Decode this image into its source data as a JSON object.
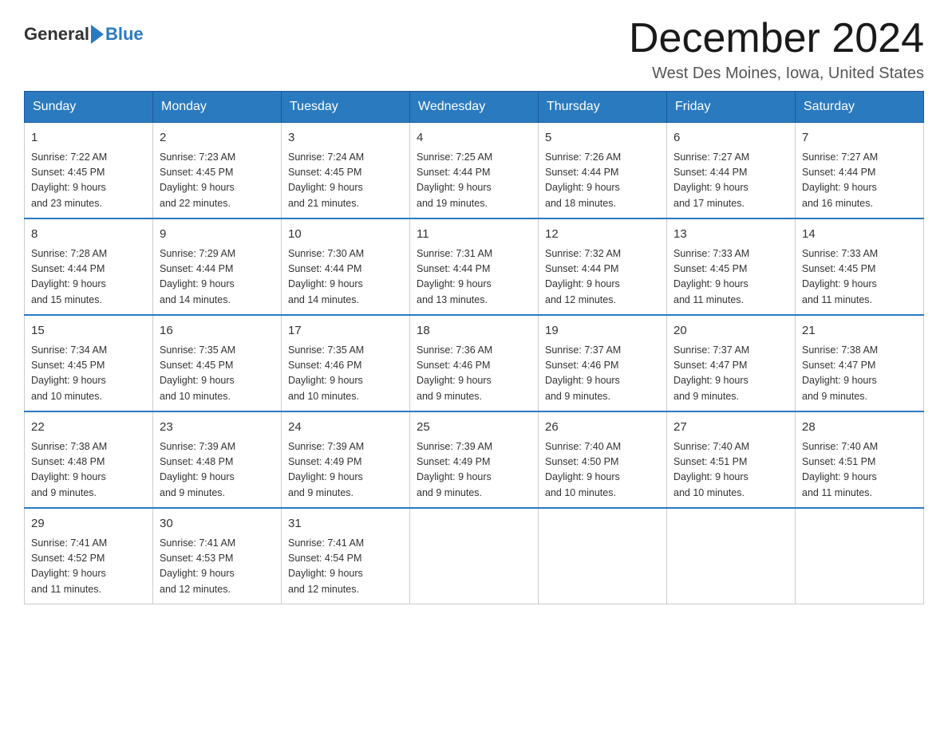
{
  "logo": {
    "text_general": "General",
    "text_blue": "Blue"
  },
  "title": {
    "month_year": "December 2024",
    "location": "West Des Moines, Iowa, United States"
  },
  "weekdays": [
    "Sunday",
    "Monday",
    "Tuesday",
    "Wednesday",
    "Thursday",
    "Friday",
    "Saturday"
  ],
  "weeks": [
    [
      {
        "day": "1",
        "sunrise": "7:22 AM",
        "sunset": "4:45 PM",
        "daylight": "9 hours and 23 minutes."
      },
      {
        "day": "2",
        "sunrise": "7:23 AM",
        "sunset": "4:45 PM",
        "daylight": "9 hours and 22 minutes."
      },
      {
        "day": "3",
        "sunrise": "7:24 AM",
        "sunset": "4:45 PM",
        "daylight": "9 hours and 21 minutes."
      },
      {
        "day": "4",
        "sunrise": "7:25 AM",
        "sunset": "4:44 PM",
        "daylight": "9 hours and 19 minutes."
      },
      {
        "day": "5",
        "sunrise": "7:26 AM",
        "sunset": "4:44 PM",
        "daylight": "9 hours and 18 minutes."
      },
      {
        "day": "6",
        "sunrise": "7:27 AM",
        "sunset": "4:44 PM",
        "daylight": "9 hours and 17 minutes."
      },
      {
        "day": "7",
        "sunrise": "7:27 AM",
        "sunset": "4:44 PM",
        "daylight": "9 hours and 16 minutes."
      }
    ],
    [
      {
        "day": "8",
        "sunrise": "7:28 AM",
        "sunset": "4:44 PM",
        "daylight": "9 hours and 15 minutes."
      },
      {
        "day": "9",
        "sunrise": "7:29 AM",
        "sunset": "4:44 PM",
        "daylight": "9 hours and 14 minutes."
      },
      {
        "day": "10",
        "sunrise": "7:30 AM",
        "sunset": "4:44 PM",
        "daylight": "9 hours and 14 minutes."
      },
      {
        "day": "11",
        "sunrise": "7:31 AM",
        "sunset": "4:44 PM",
        "daylight": "9 hours and 13 minutes."
      },
      {
        "day": "12",
        "sunrise": "7:32 AM",
        "sunset": "4:44 PM",
        "daylight": "9 hours and 12 minutes."
      },
      {
        "day": "13",
        "sunrise": "7:33 AM",
        "sunset": "4:45 PM",
        "daylight": "9 hours and 11 minutes."
      },
      {
        "day": "14",
        "sunrise": "7:33 AM",
        "sunset": "4:45 PM",
        "daylight": "9 hours and 11 minutes."
      }
    ],
    [
      {
        "day": "15",
        "sunrise": "7:34 AM",
        "sunset": "4:45 PM",
        "daylight": "9 hours and 10 minutes."
      },
      {
        "day": "16",
        "sunrise": "7:35 AM",
        "sunset": "4:45 PM",
        "daylight": "9 hours and 10 minutes."
      },
      {
        "day": "17",
        "sunrise": "7:35 AM",
        "sunset": "4:46 PM",
        "daylight": "9 hours and 10 minutes."
      },
      {
        "day": "18",
        "sunrise": "7:36 AM",
        "sunset": "4:46 PM",
        "daylight": "9 hours and 9 minutes."
      },
      {
        "day": "19",
        "sunrise": "7:37 AM",
        "sunset": "4:46 PM",
        "daylight": "9 hours and 9 minutes."
      },
      {
        "day": "20",
        "sunrise": "7:37 AM",
        "sunset": "4:47 PM",
        "daylight": "9 hours and 9 minutes."
      },
      {
        "day": "21",
        "sunrise": "7:38 AM",
        "sunset": "4:47 PM",
        "daylight": "9 hours and 9 minutes."
      }
    ],
    [
      {
        "day": "22",
        "sunrise": "7:38 AM",
        "sunset": "4:48 PM",
        "daylight": "9 hours and 9 minutes."
      },
      {
        "day": "23",
        "sunrise": "7:39 AM",
        "sunset": "4:48 PM",
        "daylight": "9 hours and 9 minutes."
      },
      {
        "day": "24",
        "sunrise": "7:39 AM",
        "sunset": "4:49 PM",
        "daylight": "9 hours and 9 minutes."
      },
      {
        "day": "25",
        "sunrise": "7:39 AM",
        "sunset": "4:49 PM",
        "daylight": "9 hours and 9 minutes."
      },
      {
        "day": "26",
        "sunrise": "7:40 AM",
        "sunset": "4:50 PM",
        "daylight": "9 hours and 10 minutes."
      },
      {
        "day": "27",
        "sunrise": "7:40 AM",
        "sunset": "4:51 PM",
        "daylight": "9 hours and 10 minutes."
      },
      {
        "day": "28",
        "sunrise": "7:40 AM",
        "sunset": "4:51 PM",
        "daylight": "9 hours and 11 minutes."
      }
    ],
    [
      {
        "day": "29",
        "sunrise": "7:41 AM",
        "sunset": "4:52 PM",
        "daylight": "9 hours and 11 minutes."
      },
      {
        "day": "30",
        "sunrise": "7:41 AM",
        "sunset": "4:53 PM",
        "daylight": "9 hours and 12 minutes."
      },
      {
        "day": "31",
        "sunrise": "7:41 AM",
        "sunset": "4:54 PM",
        "daylight": "9 hours and 12 minutes."
      },
      null,
      null,
      null,
      null
    ]
  ],
  "labels": {
    "sunrise": "Sunrise:",
    "sunset": "Sunset:",
    "daylight": "Daylight:"
  }
}
